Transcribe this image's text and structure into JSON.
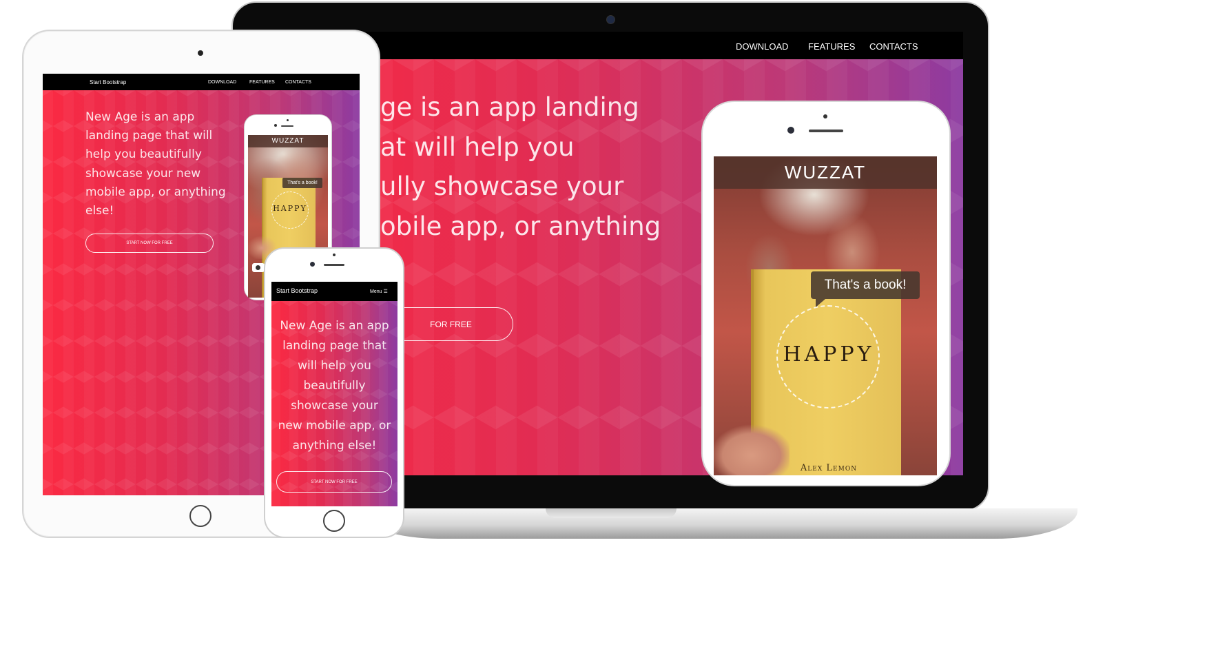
{
  "brand": "Start Bootstrap",
  "nav": {
    "download": "DOWNLOAD",
    "features": "FEATURES",
    "contacts": "CONTACTS",
    "menu": "Menu"
  },
  "hero": {
    "laptop_lines": [
      "ge is an app landing",
      "at will help you",
      "ully showcase your",
      "obile app, or anything"
    ],
    "laptop_button": "FOR FREE",
    "tablet_lines": [
      "New Age is an app",
      "landing page that will",
      "help you beautifully",
      "showcase your new",
      "mobile app, or anything",
      "else!"
    ],
    "phone_lines": [
      "New Age is an app",
      "landing page that",
      "will help you",
      "beautifully",
      "showcase your",
      "new mobile app, or",
      "anything else!"
    ],
    "button": "START NOW FOR FREE"
  },
  "app": {
    "name": "WUZZAT",
    "bubble": "That's a book!",
    "book_title": "HAPPY",
    "book_author": "Alex Lemon"
  },
  "icons": {
    "hamburger": "hamburger-icon",
    "camera": "camera-icon"
  },
  "colors": {
    "gradient_start": "#fb2a42",
    "gradient_end": "#8d3ba1",
    "navbar": "#000000"
  }
}
